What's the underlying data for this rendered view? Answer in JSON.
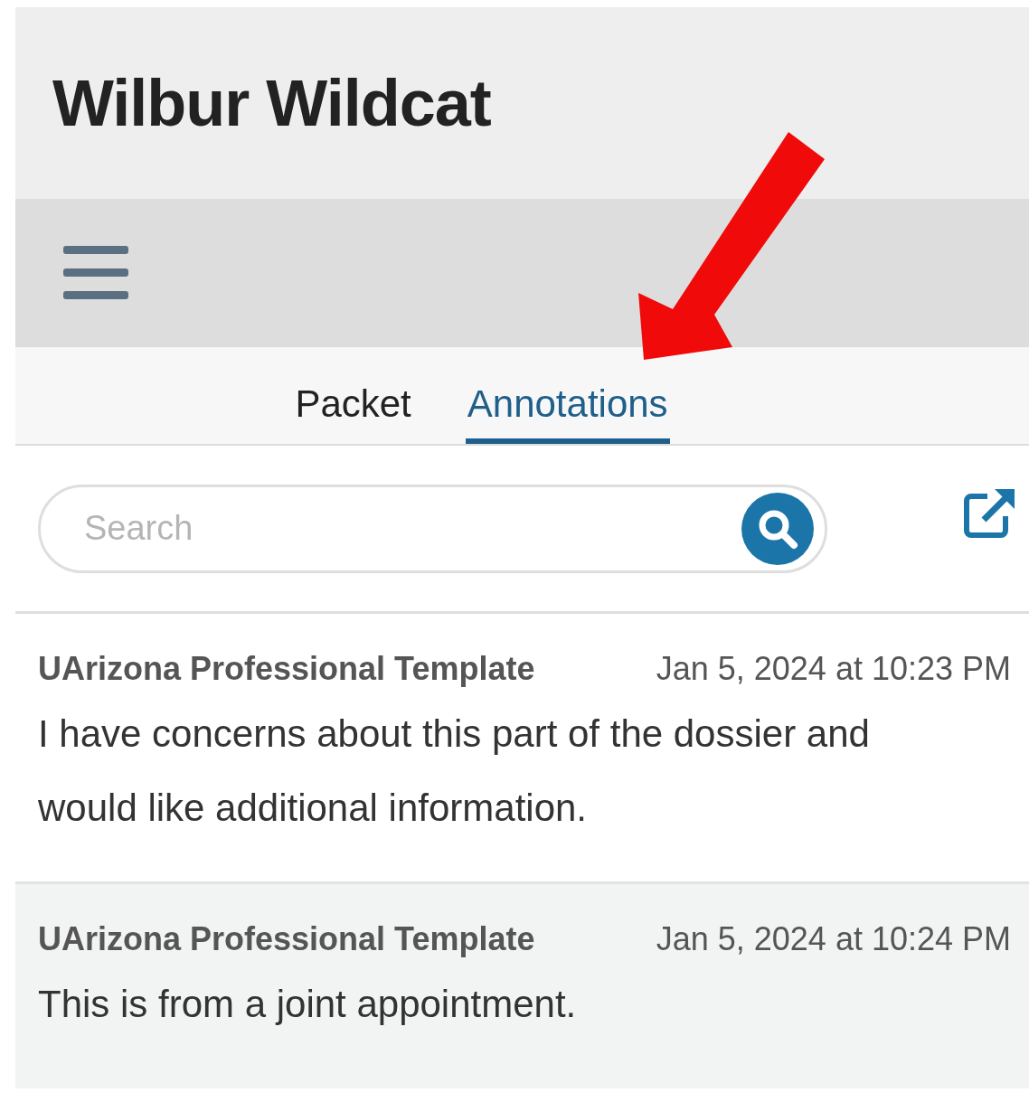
{
  "header": {
    "title": "Wilbur Wildcat"
  },
  "toolbar": {
    "menu": true
  },
  "tabs": [
    {
      "label": "Packet",
      "selected": false
    },
    {
      "label": "Annotations",
      "selected": true
    }
  ],
  "search": {
    "placeholder": "Search"
  },
  "annotations": [
    {
      "author": "UArizona Professional Template",
      "date": "Jan 5, 2024 at 10:23 PM",
      "text": "I have concerns about this part of the dossier and would like additional information.",
      "selected": false
    },
    {
      "author": "UArizona Professional Template",
      "date": "Jan 5, 2024 at 10:24 PM",
      "text": "This is from a joint appointment.",
      "selected": true
    }
  ]
}
